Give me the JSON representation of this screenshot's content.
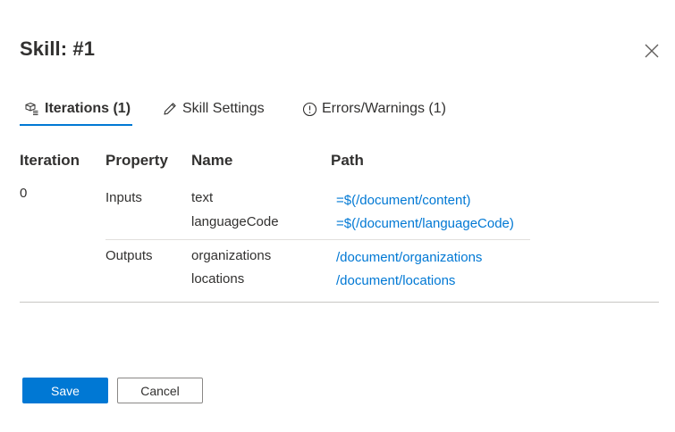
{
  "dialog": {
    "title": "Skill: #1",
    "close_icon": "close-icon"
  },
  "tabs": [
    {
      "label": "Iterations (1)",
      "icon": "cube-stack-icon",
      "active": true
    },
    {
      "label": "Skill Settings",
      "icon": "pencil-icon",
      "active": false
    },
    {
      "label": "Errors/Warnings (1)",
      "icon": "info-circle-icon",
      "active": false
    }
  ],
  "table": {
    "headers": [
      "Iteration",
      "Property",
      "Name",
      "Path"
    ],
    "iteration": "0",
    "groups": [
      {
        "property": "Inputs",
        "rows": [
          {
            "name": "text",
            "path": "=$(/document/content)"
          },
          {
            "name": "languageCode",
            "path": "=$(/document/languageCode)"
          }
        ]
      },
      {
        "property": "Outputs",
        "rows": [
          {
            "name": "organizations",
            "path": "/document/organizations"
          },
          {
            "name": "locations",
            "path": "/document/locations"
          }
        ]
      }
    ]
  },
  "actions": {
    "save_label": "Save",
    "cancel_label": "Cancel"
  },
  "colors": {
    "accent": "#0078d4",
    "text": "#323130",
    "divider": "#e1dfdd"
  }
}
